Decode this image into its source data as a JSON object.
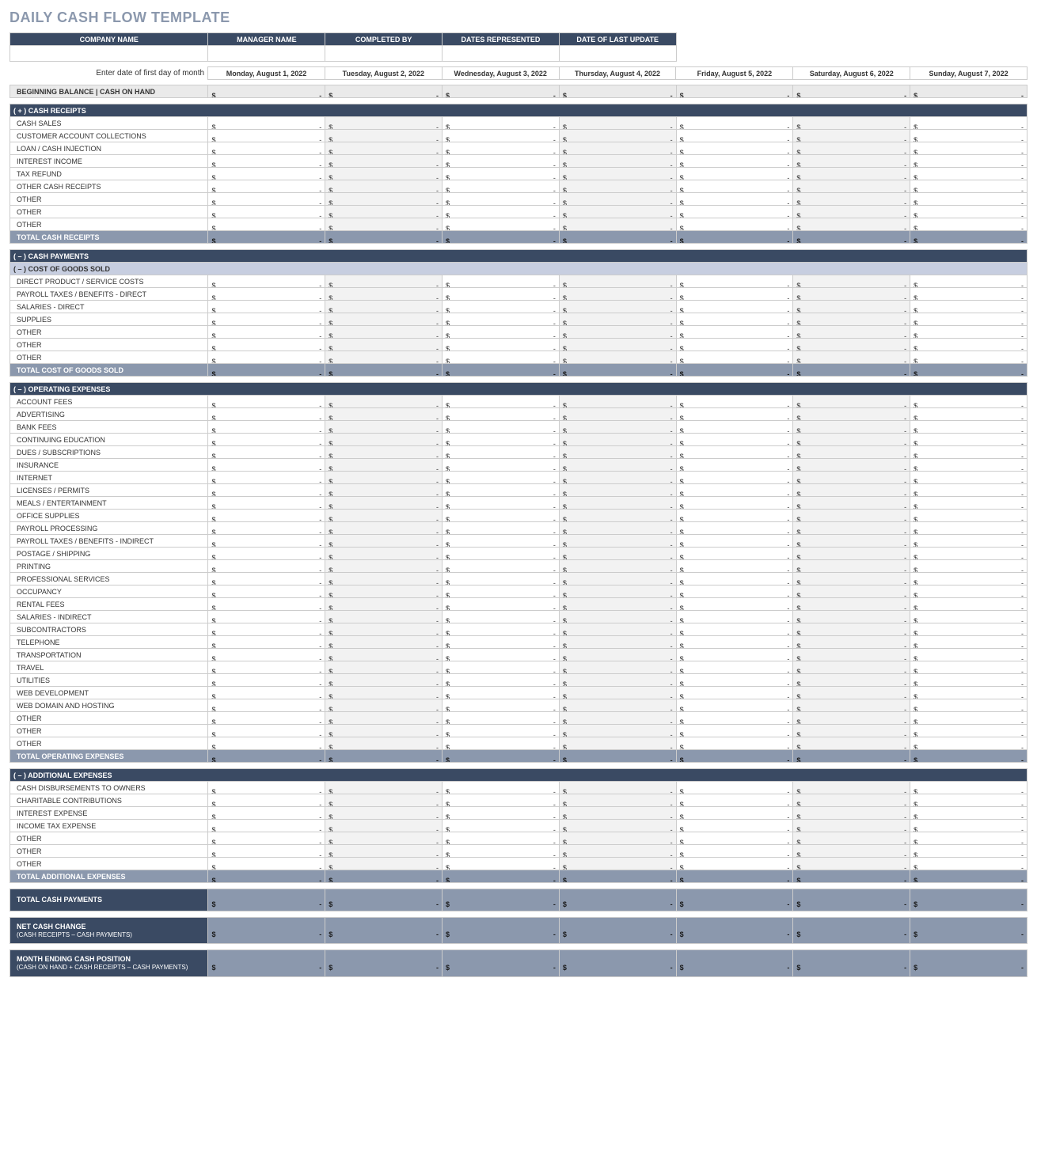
{
  "title": "DAILY CASH FLOW TEMPLATE",
  "info_headers": [
    "COMPANY NAME",
    "MANAGER NAME",
    "COMPLETED BY",
    "DATES REPRESENTED",
    "DATE OF LAST UPDATE"
  ],
  "info_values": [
    "",
    "",
    "",
    "",
    ""
  ],
  "date_prompt": "Enter date of first day of month",
  "dates": [
    "Monday, August 1, 2022",
    "Tuesday, August 2, 2022",
    "Wednesday, August 3, 2022",
    "Thursday, August 4, 2022",
    "Friday, August 5, 2022",
    "Saturday, August 6, 2022",
    "Sunday, August 7, 2022"
  ],
  "beginning_balance_label": "BEGINNING BALANCE  |  CASH ON HAND",
  "currency": "$",
  "dash": "-",
  "sections": {
    "receipts": {
      "header": "( + )  CASH RECEIPTS",
      "rows": [
        "CASH SALES",
        "CUSTOMER ACCOUNT COLLECTIONS",
        "LOAN / CASH INJECTION",
        "INTEREST INCOME",
        "TAX REFUND",
        "OTHER CASH RECEIPTS",
        "OTHER",
        "OTHER",
        "OTHER"
      ],
      "total": "TOTAL CASH RECEIPTS"
    },
    "payments_header": "( – )  CASH PAYMENTS",
    "cogs": {
      "header": "( – )  COST OF GOODS SOLD",
      "rows": [
        "DIRECT PRODUCT / SERVICE COSTS",
        "PAYROLL TAXES / BENEFITS - DIRECT",
        "SALARIES - DIRECT",
        "SUPPLIES",
        "OTHER",
        "OTHER",
        "OTHER"
      ],
      "total": "TOTAL COST OF GOODS SOLD"
    },
    "opex": {
      "header": "( – )  OPERATING EXPENSES",
      "rows": [
        "ACCOUNT FEES",
        "ADVERTISING",
        "BANK FEES",
        "CONTINUING EDUCATION",
        "DUES / SUBSCRIPTIONS",
        "INSURANCE",
        "INTERNET",
        "LICENSES / PERMITS",
        "MEALS / ENTERTAINMENT",
        "OFFICE SUPPLIES",
        "PAYROLL PROCESSING",
        "PAYROLL TAXES / BENEFITS - INDIRECT",
        "POSTAGE / SHIPPING",
        "PRINTING",
        "PROFESSIONAL SERVICES",
        "OCCUPANCY",
        "RENTAL FEES",
        "SALARIES - INDIRECT",
        "SUBCONTRACTORS",
        "TELEPHONE",
        "TRANSPORTATION",
        "TRAVEL",
        "UTILITIES",
        "WEB DEVELOPMENT",
        "WEB DOMAIN AND HOSTING",
        "OTHER",
        "OTHER",
        "OTHER"
      ],
      "total": "TOTAL OPERATING EXPENSES"
    },
    "addl": {
      "header": "( – )  ADDITIONAL EXPENSES",
      "rows": [
        "CASH DISBURSEMENTS TO OWNERS",
        "CHARITABLE CONTRIBUTIONS",
        "INTEREST EXPENSE",
        "INCOME TAX EXPENSE",
        "OTHER",
        "OTHER",
        "OTHER"
      ],
      "total": "TOTAL ADDITIONAL EXPENSES"
    }
  },
  "grand": {
    "total_payments": "TOTAL CASH PAYMENTS",
    "net_change": "NET CASH CHANGE",
    "net_change_sub": "(CASH RECEIPTS – CASH PAYMENTS)",
    "ending": "MONTH ENDING CASH POSITION",
    "ending_sub": "(CASH ON HAND + CASH RECEIPTS – CASH PAYMENTS)"
  }
}
